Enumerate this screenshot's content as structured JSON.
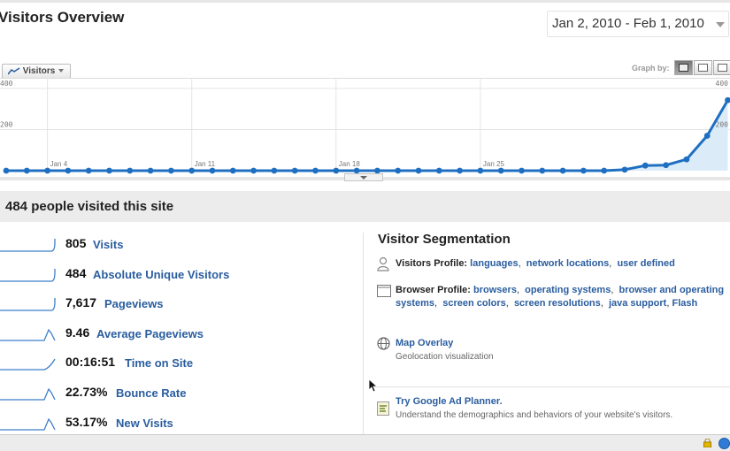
{
  "header": {
    "title": "Visitors Overview",
    "date_range": "Jan 2, 2010 - Feb 1, 2010"
  },
  "graph_controls": {
    "metric_label": "Visitors",
    "graph_by_label": "Graph by:",
    "graph_by_options": [
      "day-icon",
      "week-icon",
      "month-icon"
    ]
  },
  "chart_data": {
    "type": "area",
    "series": [
      {
        "name": "Visitors",
        "values": [
          0,
          0,
          0,
          0,
          0,
          0,
          0,
          0,
          0,
          0,
          0,
          0,
          0,
          0,
          0,
          0,
          0,
          0,
          0,
          0,
          0,
          0,
          0,
          0,
          0,
          0,
          0,
          0,
          0,
          0,
          5,
          25,
          27,
          55,
          170,
          343
        ]
      }
    ],
    "x_labels": [
      "Jan 4",
      "Jan 11",
      "Jan 18",
      "Jan 25"
    ],
    "y_ticks_left": [
      "400",
      "200"
    ],
    "y_ticks_right": [
      "400",
      "200"
    ],
    "ylim": [
      0,
      400
    ],
    "grid": true,
    "colors": {
      "line": "#1e6fc2",
      "fill": "#dcebf8"
    }
  },
  "summary": {
    "headline": "484 people visited this site"
  },
  "metrics": [
    {
      "value": "805",
      "label": "Visits",
      "spark": "step-up"
    },
    {
      "value": "484",
      "label": "Absolute Unique Visitors",
      "spark": "step-up"
    },
    {
      "value": "7,617",
      "label": "Pageviews",
      "spark": "step-up"
    },
    {
      "value": "9.46",
      "label": "Average Pageviews",
      "spark": "spike"
    },
    {
      "value": "00:16:51",
      "label": "Time on Site",
      "spark": "ramp"
    },
    {
      "value": "22.73%",
      "label": "Bounce Rate",
      "spark": "spike"
    },
    {
      "value": "53.17%",
      "label": "New Visits",
      "spark": "spike"
    }
  ],
  "segmentation": {
    "title": "Visitor Segmentation",
    "visitors_profile": {
      "label": "Visitors Profile:",
      "links": [
        "languages",
        "network locations",
        "user defined"
      ]
    },
    "browser_profile": {
      "label": "Browser Profile:",
      "links": [
        "browsers",
        "operating systems",
        "browser and operating systems",
        "screen colors",
        "screen resolutions",
        "java support",
        "Flash"
      ]
    },
    "map_overlay": {
      "link": "Map Overlay",
      "desc": "Geolocation visualization"
    },
    "ad_planner": {
      "link": "Try Google Ad Planner.",
      "desc": "Understand the demographics and behaviors of your website's visitors."
    }
  }
}
